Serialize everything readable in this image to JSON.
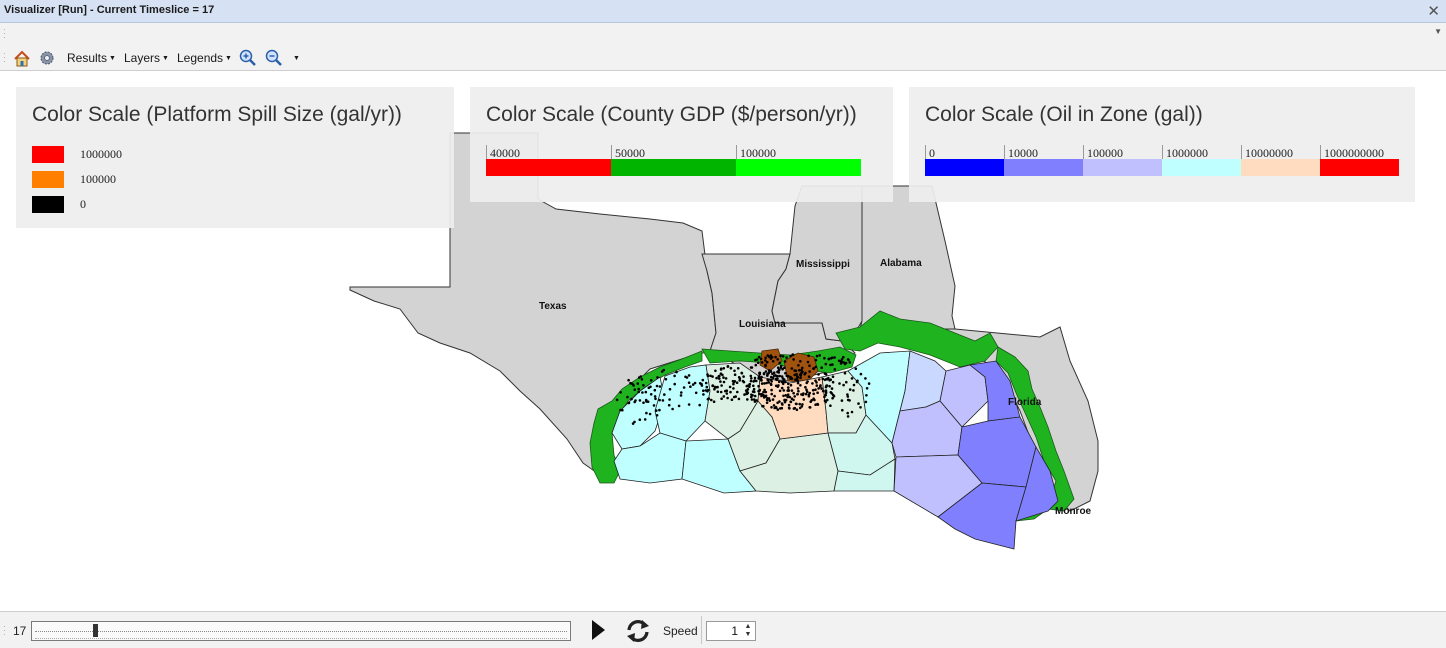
{
  "window": {
    "title": "Visualizer [Run]  - Current Timeslice = 17"
  },
  "toolbar": {
    "home_icon": "home-icon",
    "settings_icon": "gear-icon",
    "results_label": "Results",
    "layers_label": "Layers",
    "legends_label": "Legends",
    "zoom_in_icon": "zoom-in-icon",
    "zoom_out_icon": "zoom-out-icon"
  },
  "legends": {
    "spill": {
      "title": "Color Scale (Platform Spill Size (gal/yr))",
      "items": [
        {
          "label": "1000000",
          "color": "#ff0000"
        },
        {
          "label": "100000",
          "color": "#ff8000"
        },
        {
          "label": "0",
          "color": "#000000"
        }
      ]
    },
    "gdp": {
      "title": "Color Scale (County GDP ($/person/yr))",
      "items": [
        {
          "label": "40000",
          "color": "#ff0000"
        },
        {
          "label": "50000",
          "color": "#00b400"
        },
        {
          "label": "100000",
          "color": "#00ff00"
        }
      ]
    },
    "oil": {
      "title": "Color Scale (Oil in Zone (gal))",
      "items": [
        {
          "label": "0",
          "color": "#0000ff"
        },
        {
          "label": "10000",
          "color": "#8080ff"
        },
        {
          "label": "100000",
          "color": "#c0c0ff"
        },
        {
          "label": "1000000",
          "color": "#c0ffff"
        },
        {
          "label": "10000000",
          "color": "#ffdcc0"
        },
        {
          "label": "1000000000",
          "color": "#ff0000"
        }
      ]
    }
  },
  "map": {
    "labels": {
      "texas": "Texas",
      "louisiana": "Louisiana",
      "mississippi": "Mississippi",
      "alabama": "Alabama",
      "florida": "Florida",
      "monroe": "Monroe"
    }
  },
  "playback": {
    "timeslice": "17",
    "timeslice_fraction": 0.11,
    "speed_label": "Speed",
    "speed_value": "1",
    "play_icon": "play-icon",
    "refresh_icon": "refresh-icon"
  }
}
